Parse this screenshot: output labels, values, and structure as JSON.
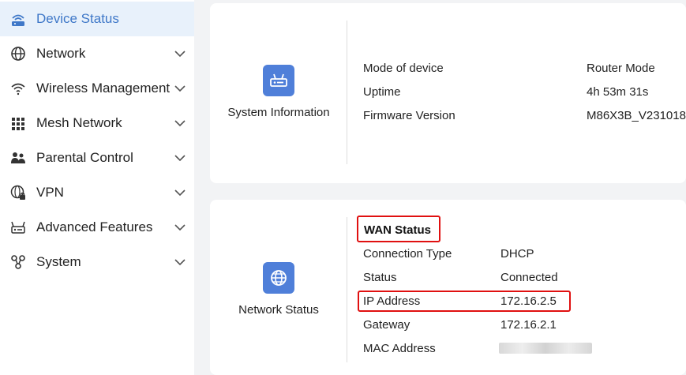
{
  "colors": {
    "accent": "#3f78c8",
    "active_bg": "#e8f1fb",
    "icon_tile": "#4f7fd9",
    "highlight_border": "#e01010"
  },
  "sidebar": {
    "items": [
      {
        "label": "Device Status",
        "icon": "router-wifi-icon",
        "active": true
      },
      {
        "label": "Network",
        "icon": "globe-icon"
      },
      {
        "label": "Wireless Management",
        "icon": "wifi-icon"
      },
      {
        "label": "Mesh Network",
        "icon": "grid-dots-icon"
      },
      {
        "label": "Parental Control",
        "icon": "family-icon"
      },
      {
        "label": "VPN",
        "icon": "globe-lock-icon"
      },
      {
        "label": "Advanced Features",
        "icon": "router-settings-icon"
      },
      {
        "label": "System",
        "icon": "cog-nodes-icon"
      }
    ]
  },
  "system_info": {
    "caption": "System Information",
    "icon": "router-icon",
    "rows": [
      {
        "label": "Mode of device",
        "value": "Router Mode"
      },
      {
        "label": "Uptime",
        "value": "4h 53m 31s"
      },
      {
        "label": "Firmware Version",
        "value": "M86X3B_V231018"
      }
    ]
  },
  "network_status": {
    "caption": "Network Status",
    "icon": "globe-icon",
    "title": "WAN Status",
    "rows": [
      {
        "label": "Connection Type",
        "value": "DHCP"
      },
      {
        "label": "Status",
        "value": "Connected"
      },
      {
        "label": "IP Address",
        "value": "172.16.2.5"
      },
      {
        "label": "Gateway",
        "value": "172.16.2.1"
      },
      {
        "label": "MAC Address",
        "value": ""
      }
    ]
  }
}
